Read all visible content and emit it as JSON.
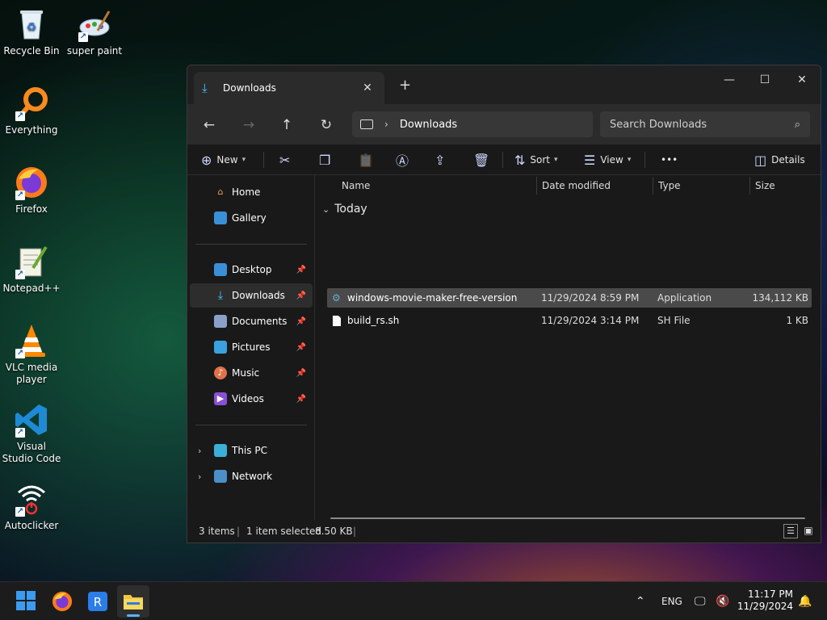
{
  "desktop": {
    "icons": [
      {
        "label": "Recycle Bin"
      },
      {
        "label": "super paint"
      },
      {
        "label": "Everything"
      },
      {
        "label": "Firefox"
      },
      {
        "label": "Notepad++"
      },
      {
        "label": "VLC media player"
      },
      {
        "label": "Visual Studio Code"
      },
      {
        "label": "Autoclicker"
      }
    ]
  },
  "window": {
    "tab_title": "Downloads",
    "tab_close": "✕",
    "new_tab": "+",
    "minimize": "—",
    "maximize": "☐",
    "close": "✕",
    "address_segment": "Downloads",
    "search_placeholder": "Search Downloads",
    "toolbar": {
      "new_label": "New",
      "sort_label": "Sort",
      "view_label": "View",
      "more_label": "•••",
      "details_label": "Details"
    },
    "sidebar": {
      "home": "Home",
      "gallery": "Gallery",
      "desktop": "Desktop",
      "downloads": "Downloads",
      "documents": "Documents",
      "pictures": "Pictures",
      "music": "Music",
      "videos": "Videos",
      "this_pc": "This PC",
      "network": "Network"
    },
    "columns": {
      "name": "Name",
      "date": "Date modified",
      "type": "Type",
      "size": "Size"
    },
    "group": "Today",
    "files": [
      {
        "name": "windows-movie-maker-free-version",
        "date": "11/29/2024 8:59 PM",
        "type": "Application",
        "size": "134,112 KB"
      },
      {
        "name": "build_rs.sh",
        "date": "11/29/2024 3:14 PM",
        "type": "SH File",
        "size": "1 KB"
      }
    ],
    "status": {
      "items": "3 items",
      "selected": "1 item selected",
      "selected_size": "8.50 KB"
    }
  },
  "taskbar": {
    "language": "ENG",
    "time": "11:17 PM",
    "date": "11/29/2024"
  }
}
